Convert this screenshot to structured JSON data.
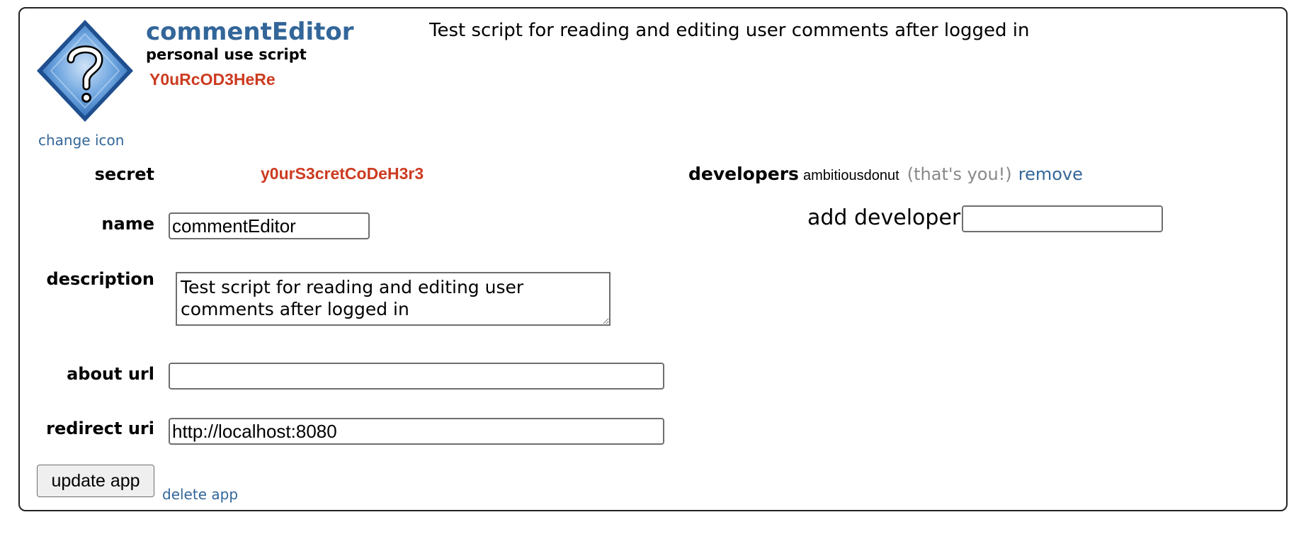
{
  "app": {
    "name": "commentEditor",
    "type_label": "personal use script",
    "client_id": "Y0uRcOD3HeRe",
    "description_display": "Test script for reading and editing user comments after logged in",
    "change_icon_label": "change icon",
    "icon": "question-mark-diamond-icon"
  },
  "form": {
    "secret_label": "secret",
    "secret_value": "y0urS3cretCoDeH3r3",
    "name_label": "name",
    "name_value": "commentEditor",
    "description_label": "description",
    "description_value": "Test script for reading and editing user comments after logged in",
    "about_url_label": "about url",
    "about_url_value": "",
    "redirect_uri_label": "redirect uri",
    "redirect_uri_value": "http://localhost:8080",
    "update_button_label": "update app",
    "delete_link_label": "delete app"
  },
  "developers": {
    "label": "developers",
    "list": [
      {
        "username": "ambitiousdonut",
        "note": "(that's you!)",
        "action": "remove"
      }
    ],
    "add_label": "add developer:",
    "add_value": ""
  },
  "colors": {
    "link": "#336699",
    "secret_text": "#cc3b20",
    "muted": "#888888"
  }
}
